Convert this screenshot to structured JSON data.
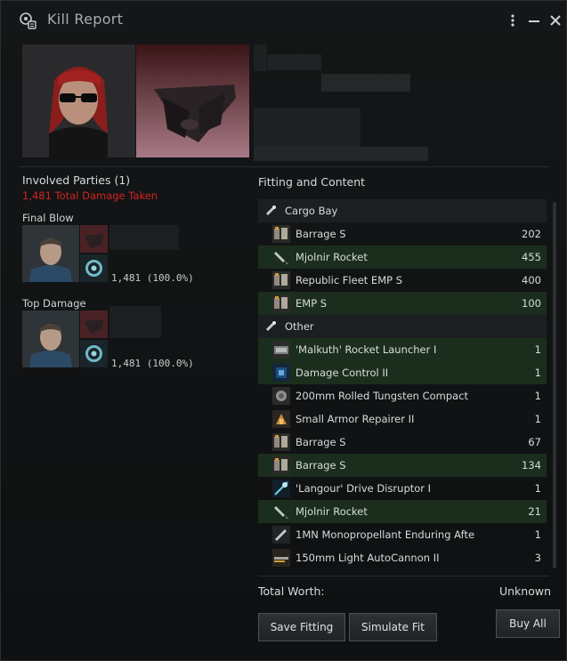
{
  "window": {
    "title": "Kill Report"
  },
  "involved": {
    "heading": "Involved Parties (1)",
    "damage_taken": "1,481 Total Damage Taken",
    "final_blow": {
      "label": "Final Blow",
      "damage": "1,481 (100.0%)"
    },
    "top_damage": {
      "label": "Top Damage",
      "damage": "1,481 (100.0%)"
    }
  },
  "fitting": {
    "title": "Fitting and Content",
    "rows": [
      {
        "kind": "header",
        "label": "Cargo Bay",
        "icon": "cargo-icon"
      },
      {
        "kind": "item",
        "label": "Barrage S",
        "qty": "202",
        "icon": "ammo-icon",
        "green": false
      },
      {
        "kind": "item",
        "label": "Mjolnir Rocket",
        "qty": "455",
        "icon": "rocket-icon",
        "green": true
      },
      {
        "kind": "item",
        "label": "Republic Fleet EMP S",
        "qty": "400",
        "icon": "ammo-icon",
        "green": false
      },
      {
        "kind": "item",
        "label": "EMP S",
        "qty": "100",
        "icon": "ammo-icon",
        "green": true
      },
      {
        "kind": "header",
        "label": "Other",
        "icon": "cargo-icon"
      },
      {
        "kind": "item",
        "label": "'Malkuth' Rocket Launcher I",
        "qty": "1",
        "icon": "launcher-icon",
        "green": true
      },
      {
        "kind": "item",
        "label": "Damage Control II",
        "qty": "1",
        "icon": "damage-control-icon",
        "green": true
      },
      {
        "kind": "item",
        "label": "200mm Rolled Tungsten Compact",
        "qty": "1",
        "icon": "plate-icon",
        "green": false
      },
      {
        "kind": "item",
        "label": "Small Armor Repairer II",
        "qty": "1",
        "icon": "repairer-icon",
        "green": false
      },
      {
        "kind": "item",
        "label": "Barrage S",
        "qty": "67",
        "icon": "ammo-icon",
        "green": false
      },
      {
        "kind": "item",
        "label": "Barrage S",
        "qty": "134",
        "icon": "ammo-icon",
        "green": true
      },
      {
        "kind": "item",
        "label": "'Langour' Drive Disruptor I",
        "qty": "1",
        "icon": "disruptor-icon",
        "green": false
      },
      {
        "kind": "item",
        "label": "Mjolnir Rocket",
        "qty": "21",
        "icon": "rocket-icon",
        "green": true
      },
      {
        "kind": "item",
        "label": "1MN Monopropellant Enduring Afte",
        "qty": "1",
        "icon": "propulsion-icon",
        "green": false
      },
      {
        "kind": "item",
        "label": "150mm Light AutoCannon II",
        "qty": "3",
        "icon": "autocannon-icon",
        "green": false
      }
    ]
  },
  "total": {
    "label": "Total Worth:",
    "value": "Unknown"
  },
  "buttons": {
    "save": "Save Fitting",
    "simulate": "Simulate Fit",
    "buy": "Buy All"
  },
  "colors": {
    "accent_red": "#d42222",
    "green_row": "#1b2e1d"
  }
}
